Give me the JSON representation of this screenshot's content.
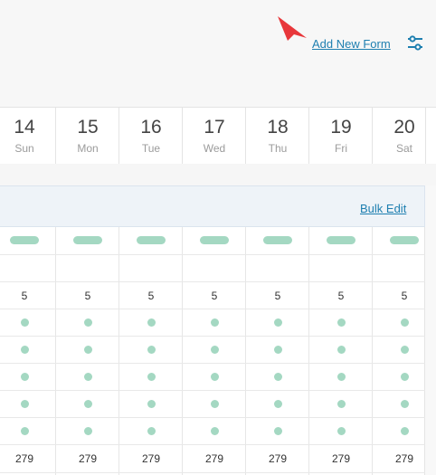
{
  "header": {
    "add_new_form_label": "Add New Form",
    "settings_icon": "sliders-icon",
    "cursor_icon": "mouse-pointer-icon",
    "accent_color": "#1e7fb0",
    "cursor_color": "#e8373b"
  },
  "calendar": {
    "days": [
      {
        "num": "14",
        "name": "Sun"
      },
      {
        "num": "15",
        "name": "Mon"
      },
      {
        "num": "16",
        "name": "Tue"
      },
      {
        "num": "17",
        "name": "Wed"
      },
      {
        "num": "18",
        "name": "Thu"
      },
      {
        "num": "19",
        "name": "Fri"
      },
      {
        "num": "20",
        "name": "Sat"
      }
    ]
  },
  "panel": {
    "bulk_edit_label": "Bulk Edit",
    "status_color": "#a4d8c2",
    "count_row": [
      "5",
      "5",
      "5",
      "5",
      "5",
      "5",
      "5"
    ],
    "total_row": [
      "279",
      "279",
      "279",
      "279",
      "279",
      "279",
      "279"
    ]
  }
}
